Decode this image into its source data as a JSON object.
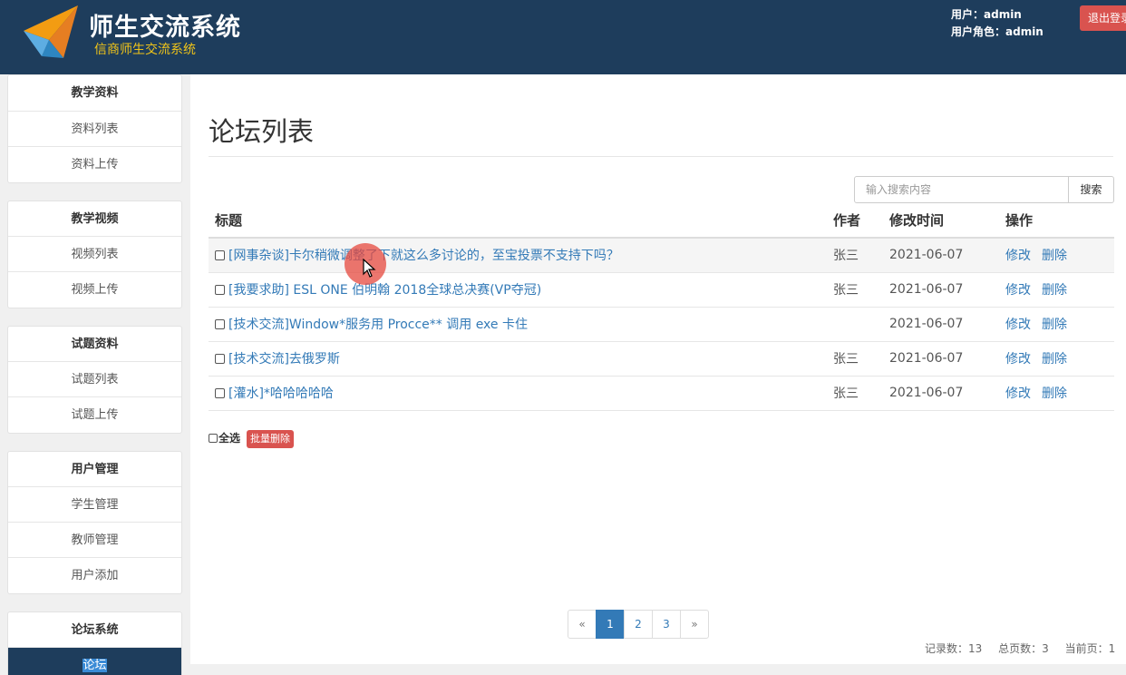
{
  "app": {
    "title": "师生交流系统",
    "subtitle": "信商师生交流系统"
  },
  "header": {
    "user_line": "用户：admin",
    "role_line": "用户角色：admin",
    "logout_label": "退出登录"
  },
  "sidebar": {
    "groups": [
      {
        "title": "教学资料",
        "items": [
          "资料列表",
          "资料上传"
        ]
      },
      {
        "title": "教学视频",
        "items": [
          "视频列表",
          "视频上传"
        ]
      },
      {
        "title": "试题资料",
        "items": [
          "试题列表",
          "试题上传"
        ]
      },
      {
        "title": "用户管理",
        "items": [
          "学生管理",
          "教师管理",
          "用户添加"
        ]
      },
      {
        "title": "论坛系统",
        "items": [
          "论坛"
        ]
      }
    ],
    "active_item": "论坛"
  },
  "main": {
    "page_title": "论坛列表",
    "search": {
      "placeholder": "输入搜索内容",
      "button_label": "搜索"
    },
    "table": {
      "columns": [
        "标题",
        "作者",
        "修改时间",
        "操作"
      ],
      "rows": [
        {
          "title": "[网事杂谈]卡尔稍微调整了下就这么多讨论的，至宝投票不支持下吗？",
          "author": "张三",
          "modified": "2021-06-07",
          "edit": "修改",
          "delete": "删除"
        },
        {
          "title": "[我要求助] ESL ONE 伯明翰 2018全球总决赛(VP夺冠)",
          "author": "张三",
          "modified": "2021-06-07",
          "edit": "修改",
          "delete": "删除"
        },
        {
          "title": "[技术交流]Window*服务用 Procce** 调用 exe 卡住",
          "author": "",
          "modified": "2021-06-07",
          "edit": "修改",
          "delete": "删除"
        },
        {
          "title": "[技术交流]去俄罗斯",
          "author": "张三",
          "modified": "2021-06-07",
          "edit": "修改",
          "delete": "删除"
        },
        {
          "title": "[灌水]*哈哈哈哈哈",
          "author": "张三",
          "modified": "2021-06-07",
          "edit": "修改",
          "delete": "删除"
        }
      ]
    },
    "select_all_label": "全选",
    "batch_delete_label": "批量删除",
    "pagination": {
      "prev": "«",
      "pages": [
        "1",
        "2",
        "3"
      ],
      "current": "1",
      "next": "»"
    },
    "stats": {
      "records": "记录数：13",
      "total_pages": "总页数：3",
      "current_page": "当前页：1"
    }
  },
  "colors": {
    "header_bg": "#1e3d5c",
    "accent_yellow": "#f0c419",
    "danger": "#d9534f",
    "link": "#337ab7"
  }
}
